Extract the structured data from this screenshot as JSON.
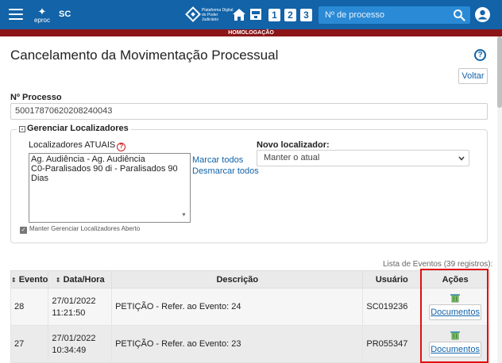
{
  "header": {
    "app_name": "eproc",
    "state": "SC",
    "pdpj_label": "Plataforma Digital do Poder Judiciário",
    "quick_buttons": [
      "1",
      "2",
      "3"
    ],
    "search_placeholder": "Nº de processo",
    "environment_banner": "HOMOLOGAÇÃO",
    "accent_color": "#1263a8",
    "banner_color": "#8c1518"
  },
  "page": {
    "title": "Cancelamento da Movimentação Processual",
    "back_label": "Voltar"
  },
  "processo": {
    "label": "Nº Processo",
    "value": "50017870620208240043"
  },
  "localizadores": {
    "legend": "Gerenciar Localizadores",
    "atuais_label": "Localizadores ATUAIS",
    "items": [
      "Ag. Audiência - Ag. Audiência",
      "C0-Paralisados 90 di - Paralisados 90 Dias"
    ],
    "marcar_todos": "Marcar todos",
    "desmarcar_todos": "Desmarcar todos",
    "novo_label": "Novo localizador:",
    "novo_selected": "Manter o atual",
    "manter_aberto": "Manter Gerenciar Localizadores Aberto"
  },
  "eventos": {
    "summary": "Lista de Eventos (39 registros):",
    "columns": {
      "evento": "Evento",
      "data_hora": "Data/Hora",
      "descricao": "Descrição",
      "usuario": "Usuário",
      "acoes": "Ações"
    },
    "rows": [
      {
        "evento": "28",
        "data": "27/01/2022",
        "hora": "11:21:50",
        "descricao": "PETIÇÃO - Refer. ao Evento: 24",
        "usuario": "SC019236",
        "acao": "Documentos"
      },
      {
        "evento": "27",
        "data": "27/01/2022",
        "hora": "10:34:49",
        "descricao": "PETIÇÃO - Refer. ao Evento: 23",
        "usuario": "PR055347",
        "acao": "Documentos"
      }
    ]
  }
}
